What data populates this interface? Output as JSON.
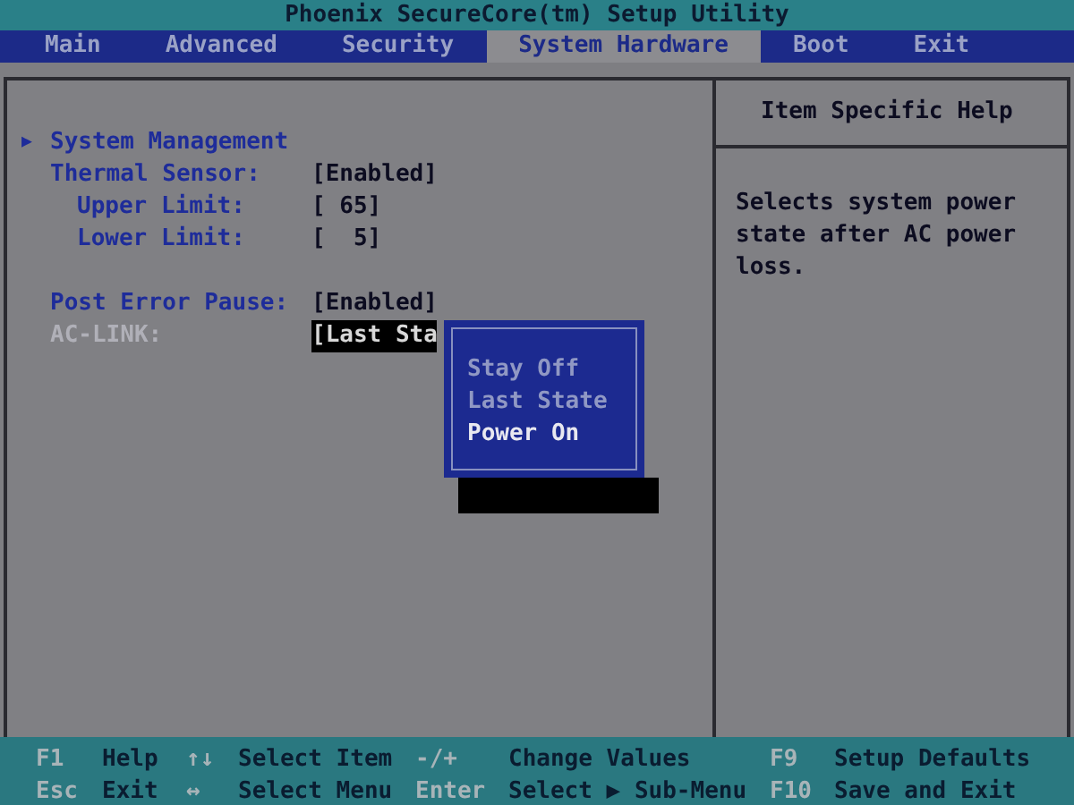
{
  "title": "Phoenix SecureCore(tm) Setup Utility",
  "tabs": [
    {
      "label": "Main",
      "selected": false
    },
    {
      "label": "Advanced",
      "selected": false
    },
    {
      "label": "Security",
      "selected": false
    },
    {
      "label": "System Hardware",
      "selected": true
    },
    {
      "label": "Boot",
      "selected": false
    },
    {
      "label": "Exit",
      "selected": false
    }
  ],
  "sections": [
    {
      "items": [
        {
          "kind": "submenu",
          "marker": "▶",
          "label": "System Management",
          "selected": false
        },
        {
          "kind": "setting",
          "label": "Thermal Sensor:",
          "value": "[Enabled]",
          "selected": false,
          "children": [
            {
              "kind": "setting",
              "label": "Upper Limit:",
              "value": "[ 65]",
              "selected": false
            },
            {
              "kind": "setting",
              "label": "Lower Limit:",
              "value": "[  5]",
              "selected": false
            }
          ]
        }
      ]
    },
    {
      "items": [
        {
          "kind": "setting",
          "label": "Post Error Pause:",
          "value": "[Enabled]",
          "selected": false
        },
        {
          "kind": "setting",
          "label": "AC-LINK:",
          "value": "[Last Sta",
          "selected": true
        }
      ]
    }
  ],
  "popup": {
    "options": [
      {
        "label": "Stay Off",
        "selected": false
      },
      {
        "label": "Last State",
        "selected": false
      },
      {
        "label": "Power On",
        "selected": true
      }
    ]
  },
  "help": {
    "heading": "Item Specific Help",
    "text": "Selects system power state after AC power loss."
  },
  "footer": [
    [
      {
        "key": "F1",
        "action": "Help"
      },
      {
        "key": "↑↓",
        "action": "Select Item"
      },
      {
        "key": "-/+",
        "action": "Change Values"
      },
      {
        "key": "F9",
        "action": "Setup Defaults"
      }
    ],
    [
      {
        "key": "Esc",
        "action": "Exit"
      },
      {
        "key": "↔",
        "action": "Select Menu"
      },
      {
        "key": "Enter",
        "action": "Select ▶ Sub-Menu"
      },
      {
        "key": "F10",
        "action": "Save and Exit"
      }
    ]
  ]
}
